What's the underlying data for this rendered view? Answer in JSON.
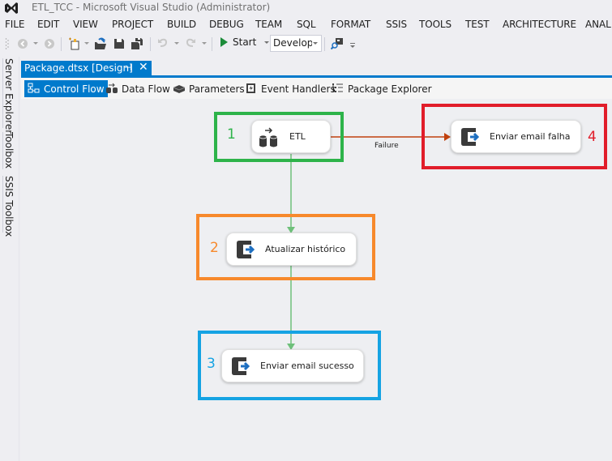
{
  "window": {
    "title": "ETL_TCC - Microsoft Visual Studio (Administrator)"
  },
  "menu": [
    {
      "label": "FILE"
    },
    {
      "label": "EDIT"
    },
    {
      "label": "VIEW"
    },
    {
      "label": "PROJECT"
    },
    {
      "label": "BUILD"
    },
    {
      "label": "DEBUG"
    },
    {
      "label": "TEAM"
    },
    {
      "label": "SQL"
    },
    {
      "label": "FORMAT"
    },
    {
      "label": "SSIS"
    },
    {
      "label": "TOOLS"
    },
    {
      "label": "TEST"
    },
    {
      "label": "ARCHITECTURE"
    },
    {
      "label": "ANAL"
    }
  ],
  "toolbar": {
    "start_label": "Start",
    "configuration": "Developi",
    "icons": [
      "back-icon",
      "forward-icon",
      "new-project-icon",
      "open-file-icon",
      "save-icon",
      "save-all-icon",
      "undo-icon",
      "redo-icon",
      "start-icon",
      "find-icon"
    ]
  },
  "side_tabs": [
    {
      "label": "Server Explorer"
    },
    {
      "label": "Toolbox"
    },
    {
      "label": "SSIS Toolbox"
    }
  ],
  "document_tab": {
    "label": "Package.dtsx [Design]",
    "pin": "⊣",
    "close": "✕"
  },
  "designer_tabs": [
    {
      "label": "Control Flow",
      "active": true,
      "icon": "control-flow-icon"
    },
    {
      "label": "Data Flow",
      "active": false,
      "icon": "data-flow-icon"
    },
    {
      "label": "Parameters",
      "active": false,
      "icon": "parameters-icon"
    },
    {
      "label": "Event Handlers",
      "active": false,
      "icon": "event-handlers-icon"
    },
    {
      "label": "Package Explorer",
      "active": false,
      "icon": "package-explorer-icon"
    }
  ],
  "tasks": [
    {
      "id": "etl",
      "label": "ETL",
      "icon": "data-flow-task-icon"
    },
    {
      "id": "enviar-email-falha",
      "label": "Enviar email falha",
      "icon": "execute-task-icon"
    },
    {
      "id": "atualizar-historico",
      "label": "Atualizar histórico",
      "icon": "execute-task-icon"
    },
    {
      "id": "enviar-email-sucesso",
      "label": "Enviar email sucesso",
      "icon": "execute-task-icon"
    }
  ],
  "connections": [
    {
      "from": "ETL",
      "to": "Enviar email falha",
      "type": "failure",
      "label": "Failure",
      "color": "#c0410e"
    },
    {
      "from": "ETL",
      "to": "Atualizar histórico",
      "type": "success",
      "label": "",
      "color": "#6ec07a"
    },
    {
      "from": "Atualizar histórico",
      "to": "Enviar email sucesso",
      "type": "success",
      "label": "",
      "color": "#6ec07a"
    }
  ],
  "annotations": [
    {
      "number": "1",
      "color": "#2db34a"
    },
    {
      "number": "2",
      "color": "#f7892c"
    },
    {
      "number": "3",
      "color": "#15a3e3"
    },
    {
      "number": "4",
      "color": "#e11d2a"
    }
  ]
}
